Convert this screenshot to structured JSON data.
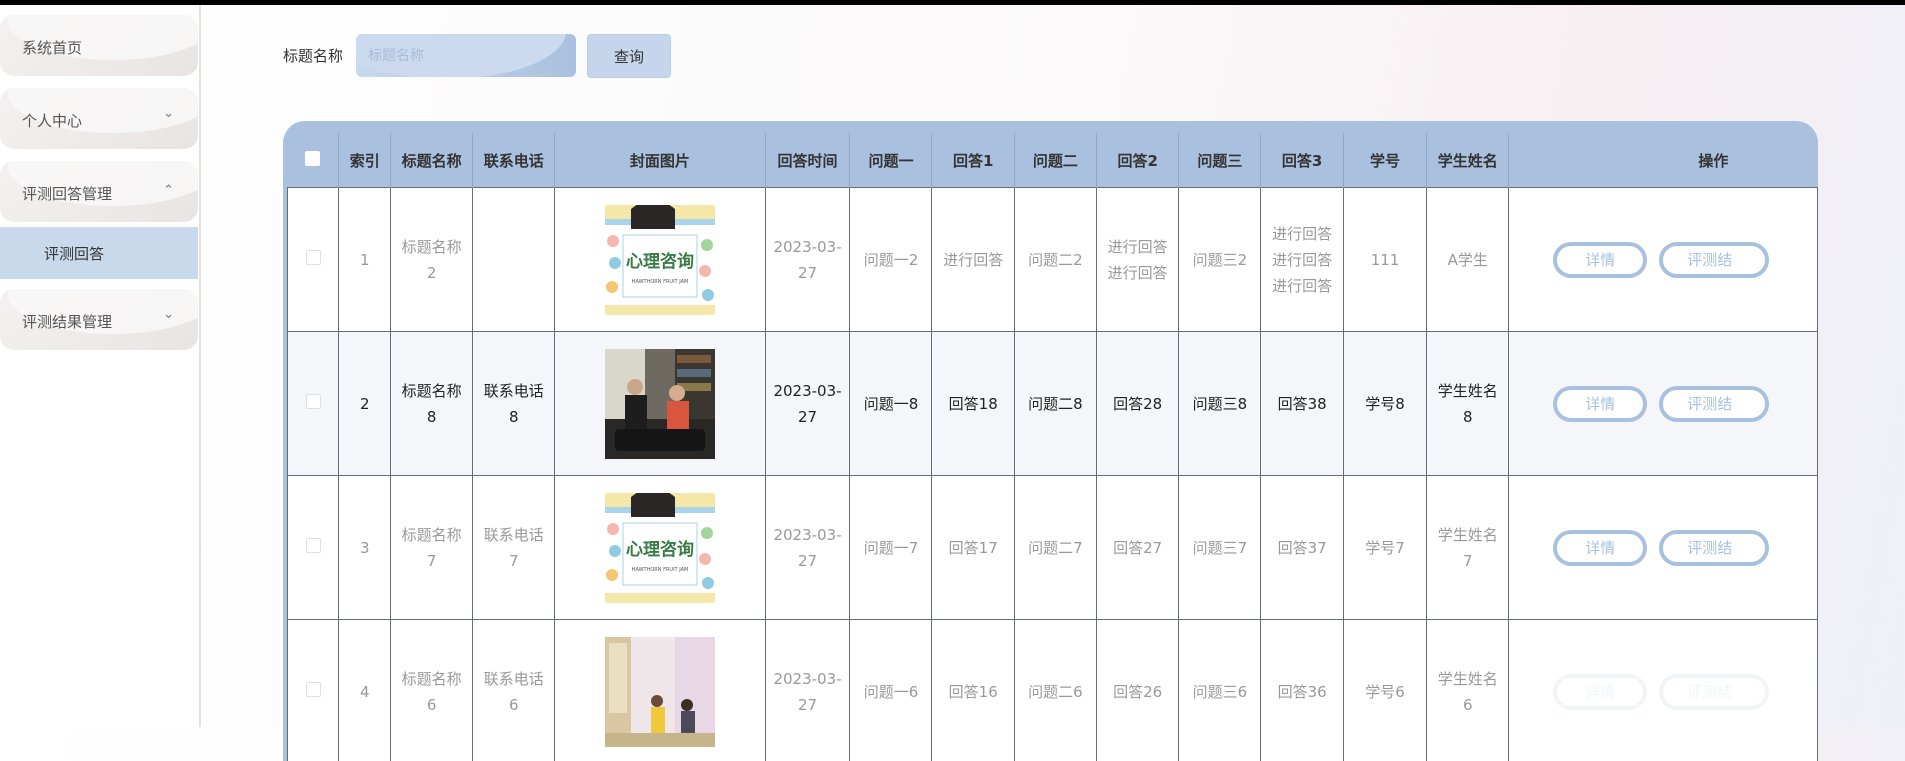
{
  "sidebar": {
    "items": [
      {
        "label": "系统首页"
      },
      {
        "label": "个人中心"
      },
      {
        "label": "评测回答管理"
      },
      {
        "label": "评测结果管理"
      }
    ],
    "sub_item": "评测回答"
  },
  "search": {
    "label": "标题名称",
    "placeholder": "标题名称",
    "button": "查询"
  },
  "table": {
    "headers": [
      "索引",
      "标题名称",
      "联系电话",
      "封面图片",
      "回答时间",
      "问题一",
      "回答1",
      "问题二",
      "回答2",
      "问题三",
      "回答3",
      "学号",
      "学生姓名",
      "操作"
    ],
    "rows": [
      {
        "index": "1",
        "title": "标题名称2",
        "phone": "",
        "time": "2023-03-27",
        "q1": "问题一2",
        "a1": "进行回答",
        "q2": "问题二2",
        "a2": "进行回答进行回答",
        "q3": "问题三2",
        "a3": "进行回答进行回答进行回答",
        "sid": "111",
        "name": "A学生",
        "image": "poster"
      },
      {
        "index": "2",
        "title": "标题名称8",
        "phone": "联系电话8",
        "time": "2023-03-27",
        "q1": "问题一8",
        "a1": "回答18",
        "q2": "问题二8",
        "a2": "回答28",
        "q3": "问题三8",
        "a3": "回答38",
        "sid": "学号8",
        "name": "学生姓名8",
        "image": "photo-counseling"
      },
      {
        "index": "3",
        "title": "标题名称7",
        "phone": "联系电话7",
        "time": "2023-03-27",
        "q1": "问题一7",
        "a1": "回答17",
        "q2": "问题二7",
        "a2": "回答27",
        "q3": "问题三7",
        "a3": "回答37",
        "sid": "学号7",
        "name": "学生姓名7",
        "image": "poster"
      },
      {
        "index": "4",
        "title": "标题名称6",
        "phone": "联系电话6",
        "time": "2023-03-27",
        "q1": "问题一6",
        "a1": "回答16",
        "q2": "问题二6",
        "a2": "回答26",
        "q3": "问题三6",
        "a3": "回答36",
        "sid": "学号6",
        "name": "学生姓名6",
        "image": "photo-room"
      }
    ],
    "actions": {
      "detail": "详情",
      "evaluate": "评测结"
    },
    "poster_title": "心理咨询",
    "poster_subtitle": "HAWTHORN FRUIT JAM"
  }
}
